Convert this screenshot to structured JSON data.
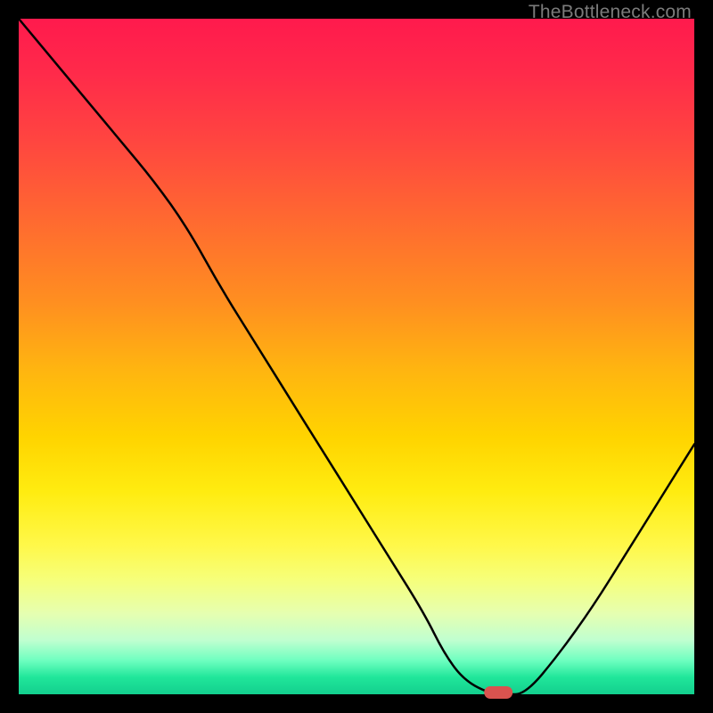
{
  "watermark": "TheBottleneck.com",
  "colors": {
    "page_bg": "#000000",
    "curve": "#000000",
    "marker": "#d9534f",
    "gradient_top": "#ff1a4d",
    "gradient_bottom": "#13cf8e"
  },
  "chart_data": {
    "type": "line",
    "title": "",
    "xlabel": "",
    "ylabel": "",
    "xlim": [
      0,
      100
    ],
    "ylim": [
      0,
      100
    ],
    "series": [
      {
        "name": "bottleneck-curve",
        "x": [
          0,
          5,
          10,
          15,
          20,
          25,
          30,
          35,
          40,
          45,
          50,
          55,
          60,
          63,
          66,
          70,
          72,
          75,
          80,
          85,
          90,
          95,
          100
        ],
        "y": [
          100,
          94,
          88,
          82,
          76,
          69,
          60,
          52,
          44,
          36,
          28,
          20,
          12,
          6,
          2,
          0,
          0,
          0,
          6,
          13,
          21,
          29,
          37
        ]
      }
    ],
    "marker": {
      "x": 71,
      "y": 0,
      "shape": "pill"
    },
    "background": "red-yellow-green vertical gradient"
  }
}
